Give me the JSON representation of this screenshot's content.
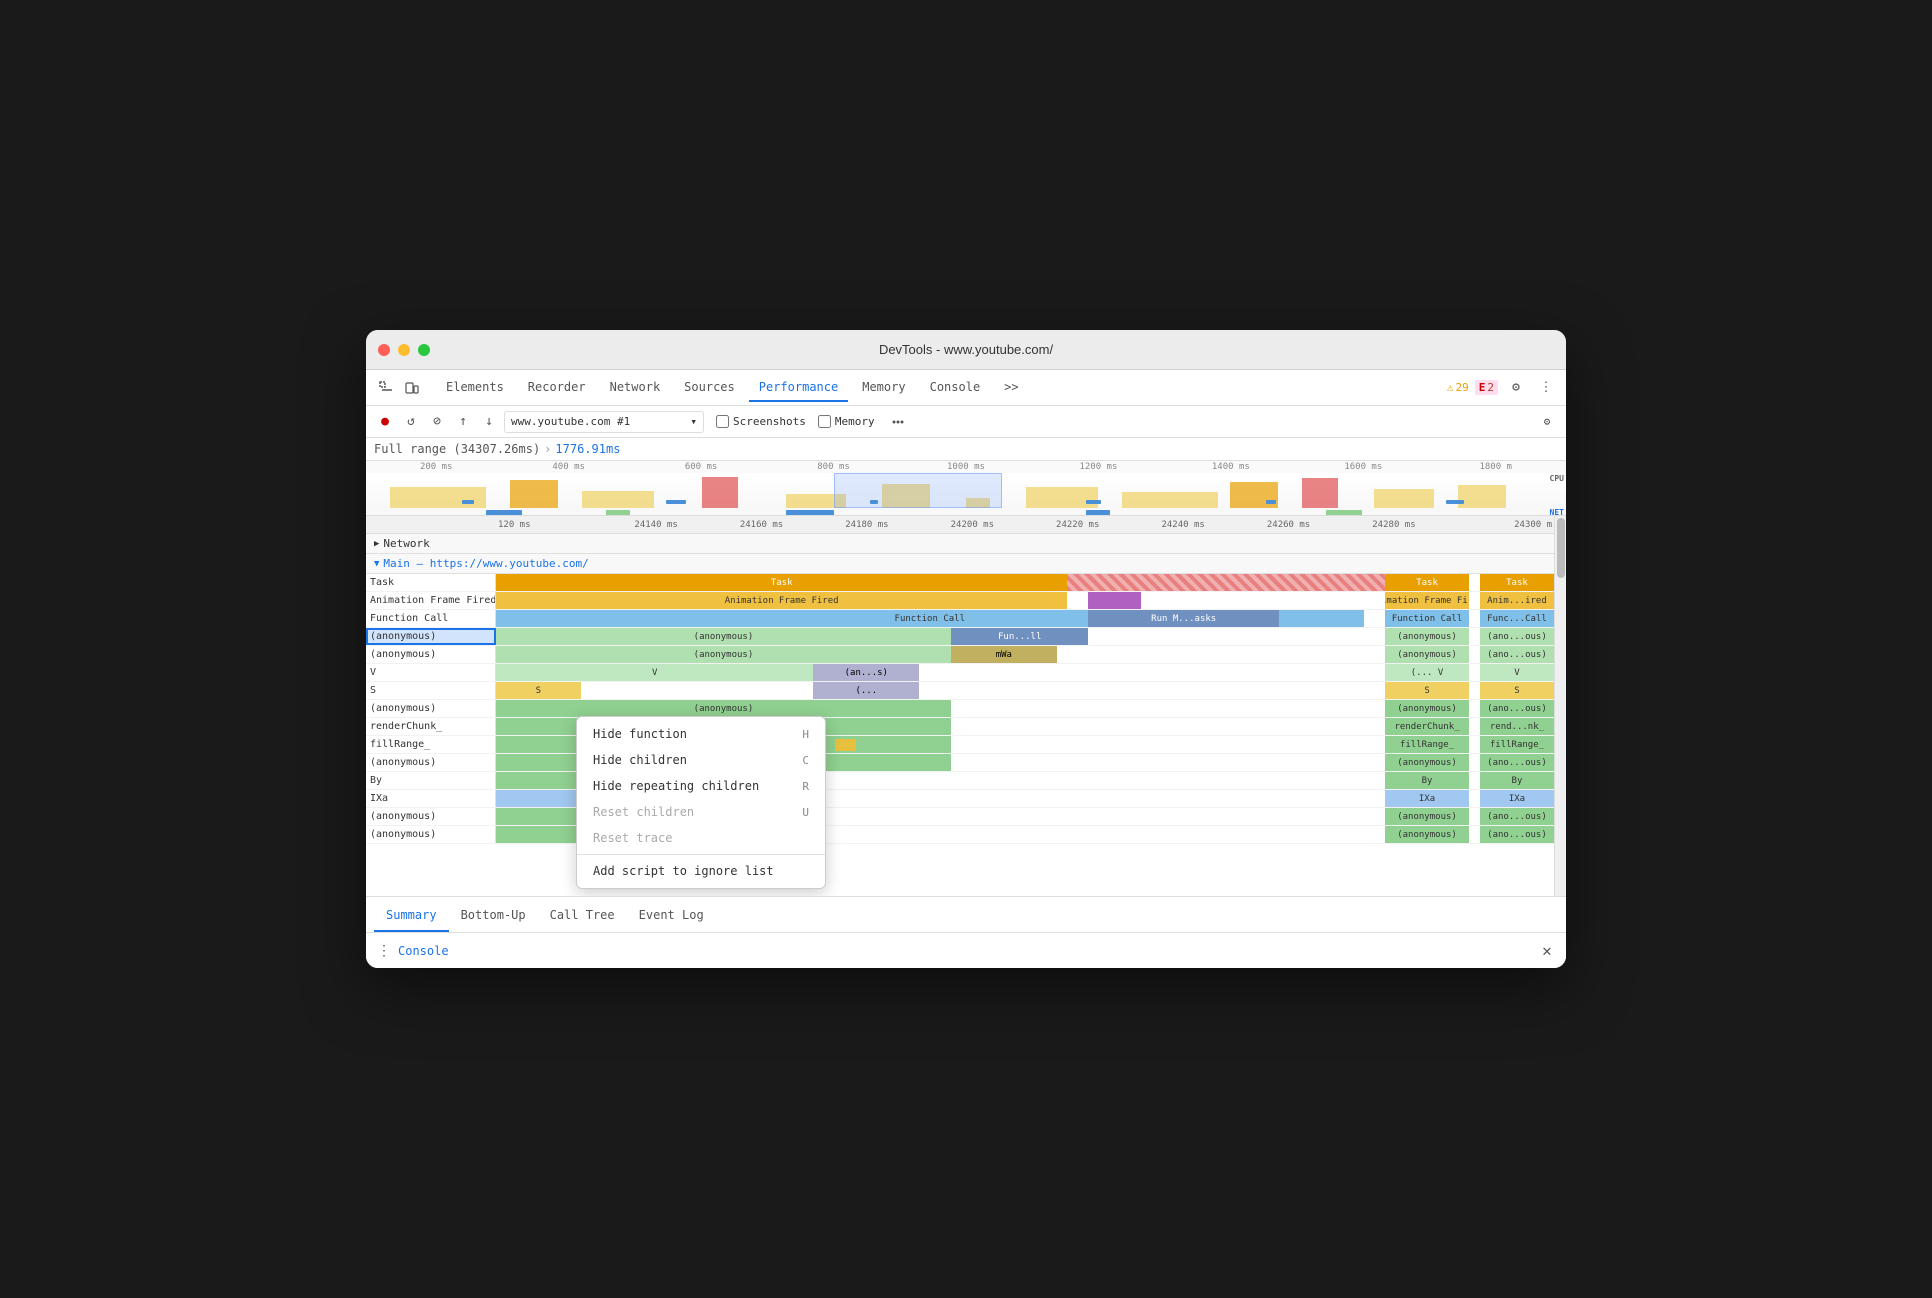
{
  "window": {
    "title": "DevTools - www.youtube.com/"
  },
  "nav": {
    "tabs": [
      {
        "id": "elements",
        "label": "Elements",
        "active": false
      },
      {
        "id": "recorder",
        "label": "Recorder",
        "active": false
      },
      {
        "id": "network",
        "label": "Network",
        "active": false
      },
      {
        "id": "sources",
        "label": "Sources",
        "active": false
      },
      {
        "id": "performance",
        "label": "Performance",
        "active": true
      },
      {
        "id": "memory",
        "label": "Memory",
        "active": false
      },
      {
        "id": "console",
        "label": "Console",
        "active": false
      },
      {
        "id": "more",
        "label": ">>",
        "active": false
      }
    ],
    "warnings": "29",
    "errors": "2"
  },
  "toolbar": {
    "url_value": "www.youtube.com #1",
    "screenshots_label": "Screenshots",
    "memory_label": "Memory"
  },
  "breadcrumb": {
    "full_range": "Full range (34307.26ms)",
    "arrow": "›",
    "selected": "1776.91ms"
  },
  "timeline": {
    "scale": [
      "200 ms",
      "400 ms",
      "600 ms",
      "800 ms",
      "1000 ms",
      "1200 ms",
      "1400 ms",
      "1600 ms",
      "1800 m"
    ],
    "cpu_label": "CPU",
    "net_label": "NET"
  },
  "time_ruler": {
    "items": [
      "120 ms",
      "24140 ms",
      "24160 ms",
      "24180 ms",
      "24200 ms",
      "24220 ms",
      "24240 ms",
      "24260 ms",
      "24280 ms",
      "24300 m"
    ]
  },
  "network_row": {
    "label": "Network",
    "collapsed": false
  },
  "main_row": {
    "label": "Main — https://www.youtube.com/"
  },
  "flame_rows": {
    "left_col": [
      {
        "label": "Task",
        "bar_text": "",
        "bar_type": "bar-task",
        "bar_left": "0%",
        "bar_width": "54%"
      },
      {
        "label": "Animation Frame Fired",
        "bar_type": "bar-anim",
        "bar_left": "0%",
        "bar_width": "54%"
      },
      {
        "label": "Function Call",
        "bar_type": "bar-func",
        "bar_left": "0%",
        "bar_width": "82%"
      },
      {
        "label": "(anonymous)",
        "bar_type": "bar-anon",
        "bar_left": "0%",
        "bar_width": "43%",
        "selected": true
      },
      {
        "label": "(anonymous)",
        "bar_type": "bar-anon",
        "bar_left": "0%",
        "bar_width": "43%"
      },
      {
        "label": "V",
        "bar_type": "bar-v",
        "bar_left": "0%",
        "bar_width": "30%"
      },
      {
        "label": "S",
        "bar_type": "bar-s",
        "bar_left": "0%",
        "bar_width": "8%"
      },
      {
        "label": "(anonymous)",
        "bar_type": "bar-green",
        "bar_left": "0%",
        "bar_width": "43%"
      },
      {
        "label": "renderChunk_",
        "bar_type": "bar-green",
        "bar_left": "0%",
        "bar_width": "43%"
      },
      {
        "label": "fillRange_",
        "bar_type": "bar-green",
        "bar_left": "0%",
        "bar_width": "43%"
      },
      {
        "label": "(anonymous)",
        "bar_type": "bar-green",
        "bar_left": "0%",
        "bar_width": "43%"
      },
      {
        "label": "By",
        "bar_type": "bar-green",
        "bar_left": "0%",
        "bar_width": "30%"
      },
      {
        "label": "IXa",
        "bar_type": "bar-blue",
        "bar_left": "0%",
        "bar_width": "30%"
      },
      {
        "label": "(anonymous)",
        "bar_type": "bar-green",
        "bar_left": "0%",
        "bar_width": "30%"
      },
      {
        "label": "(anonymous)",
        "bar_type": "bar-green",
        "bar_left": "0%",
        "bar_width": "30%"
      }
    ],
    "middle_col_bars": [
      {
        "text": "Fun...ll",
        "type": "bar-func",
        "left": "0%",
        "width": "100%"
      },
      {
        "text": "mWa",
        "type": "bar-anon",
        "left": "0%",
        "width": "100%"
      },
      {
        "text": "(an...s)",
        "type": "bar-anon",
        "left": "0%",
        "width": "100%"
      },
      {
        "text": "(..)",
        "type": "bar-green",
        "left": "0%",
        "width": "100%"
      },
      {
        "text": "",
        "type": "",
        "left": "0%",
        "width": "0%"
      },
      {
        "text": "",
        "type": "",
        "left": "0%",
        "width": "0%"
      },
      {
        "text": "",
        "type": "",
        "left": "0%",
        "width": "0%"
      },
      {
        "text": "",
        "type": "",
        "left": "0%",
        "width": "0%"
      }
    ],
    "right_tasks": [
      {
        "label1": "Task",
        "label2": "Task"
      },
      {
        "label1": "Animation Frame Fired",
        "label2": "Anim...ired"
      },
      {
        "label1": "Function Call",
        "label2": "Func...Call"
      },
      {
        "label1": "(anonymous)",
        "label2": "(ano...ous)"
      },
      {
        "label1": "(anonymous)",
        "label2": "(ano...ous)"
      },
      {
        "label1": "(... V",
        "label2": "V"
      },
      {
        "label1": "S",
        "label2": "S"
      },
      {
        "label1": "(anonymous)",
        "label2": "(ano...ous)"
      },
      {
        "label1": "renderChunk_",
        "label2": "rend...nk_"
      },
      {
        "label1": "fillRange_",
        "label2": "fillRange_"
      },
      {
        "label1": "(anonymous)",
        "label2": "(ano...ous)"
      },
      {
        "label1": "By",
        "label2": "By"
      },
      {
        "label1": "IXa",
        "label2": "IXa"
      },
      {
        "label1": "(anonymous)",
        "label2": "(ano...ous)"
      },
      {
        "label1": "(anonymous)",
        "label2": "(ano...ous)"
      }
    ]
  },
  "context_menu": {
    "items": [
      {
        "label": "Hide function",
        "shortcut": "H",
        "disabled": false
      },
      {
        "label": "Hide children",
        "shortcut": "C",
        "disabled": false
      },
      {
        "label": "Hide repeating children",
        "shortcut": "R",
        "disabled": false
      },
      {
        "label": "Reset children",
        "shortcut": "U",
        "disabled": true
      },
      {
        "label": "Reset trace",
        "shortcut": "",
        "disabled": true
      },
      {
        "label": "Add script to ignore list",
        "shortcut": "",
        "disabled": false
      }
    ]
  },
  "bottom_tabs": [
    {
      "label": "Summary",
      "active": true
    },
    {
      "label": "Bottom-Up",
      "active": false
    },
    {
      "label": "Call Tree",
      "active": false
    },
    {
      "label": "Event Log",
      "active": false
    }
  ],
  "console_bar": {
    "label": "Console",
    "close": "✕"
  }
}
